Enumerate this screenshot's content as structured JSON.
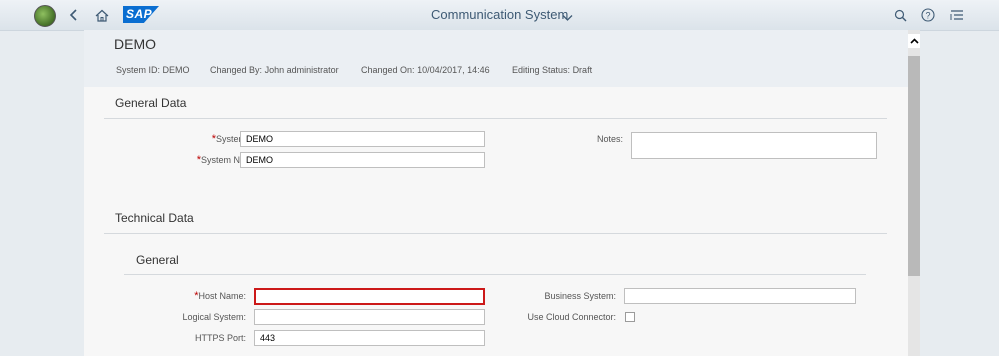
{
  "shell": {
    "app_title": "Communication System",
    "logo_text": "SAP"
  },
  "header": {
    "title": "DEMO",
    "attrs": [
      {
        "label": "System ID:",
        "value": "DEMO"
      },
      {
        "label": "Changed By:",
        "value": "John administrator"
      },
      {
        "label": "Changed On:",
        "value": "10/04/2017, 14:46"
      },
      {
        "label": "Editing Status:",
        "value": "Draft"
      }
    ]
  },
  "general_data": {
    "title": "General Data",
    "system_id_label": "System ID:",
    "system_id_value": "DEMO",
    "system_name_label": "System Name:",
    "system_name_value": "DEMO",
    "notes_label": "Notes:"
  },
  "technical_data": {
    "title": "Technical Data",
    "general_title": "General",
    "host_name_label": "Host Name:",
    "host_name_value": "",
    "logical_system_label": "Logical System:",
    "logical_system_value": "",
    "https_port_label": "HTTPS Port:",
    "https_port_value": "443",
    "business_system_label": "Business System:",
    "business_system_value": "",
    "cloud_connector_label": "Use Cloud Connector:",
    "cloud_connector_checked": false
  },
  "colors": {
    "accent": "#0a6ed1",
    "error": "#cc1919",
    "required": "#bb0000"
  }
}
